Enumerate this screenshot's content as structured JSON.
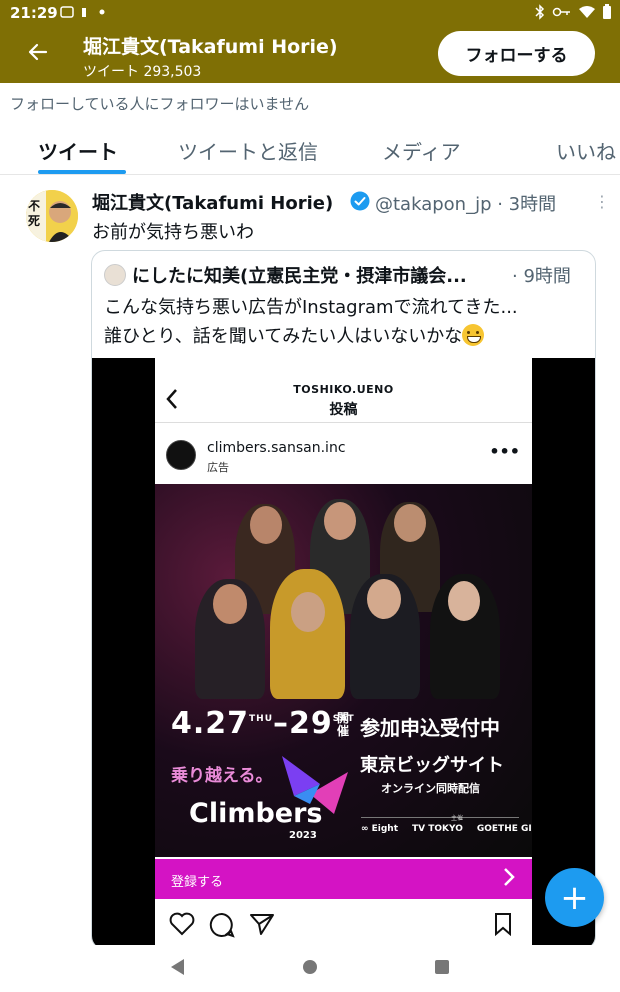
{
  "status_bar": {
    "time": "21:29"
  },
  "header": {
    "name": "堀江貴文(Takafumi Horie)",
    "subtitle": "ツイート 293,503",
    "follow_label": "フォローする"
  },
  "notice": "フォローしている人にフォロワーはいません",
  "tabs": [
    {
      "label": "ツイート",
      "active": true
    },
    {
      "label": "ツイートと返信",
      "active": false
    },
    {
      "label": "メディア",
      "active": false
    },
    {
      "label": "いいね",
      "active": false
    }
  ],
  "tweet": {
    "name": "堀江貴文(Takafumi Horie)",
    "handle_time": "@takapon_jp · 3時間",
    "text": "お前が気持ち悪いわ",
    "more": "⋮",
    "quote": {
      "name": "にしたに知美(立憲民主党・摂津市議会...",
      "time": "· 9時間",
      "line1": "こんな気持ち悪い広告がInstagramで流れてきた...",
      "line2": "誰ひとり、話を聞いてみたい人はいないかな"
    }
  },
  "instagram": {
    "owner": "TOSHIKO.UENO",
    "post_title": "投稿",
    "account": "climbers.sansan.inc",
    "ad_label": "広告",
    "more": "•••",
    "ad": {
      "date_start": "4.27",
      "day_start": "THU",
      "date_end": "–29",
      "day_end": "SAT",
      "kaisai": "開催",
      "entry": "参加申込受付中",
      "catchphrase": "乗り越える。",
      "venue": "東京ビッグサイト",
      "online": "オンライン同時配信",
      "logo": "Climbers",
      "year": "2023",
      "sponsor_label": "主催",
      "sponsors": [
        "∞ Eight",
        "TV TOKYO",
        "GOETHE GINGER"
      ]
    },
    "cta": "登録する"
  },
  "fab_label": "+",
  "colors": {
    "header_bg": "#7f6f05",
    "accent": "#1d9bf0",
    "cta": "#d413c4"
  }
}
